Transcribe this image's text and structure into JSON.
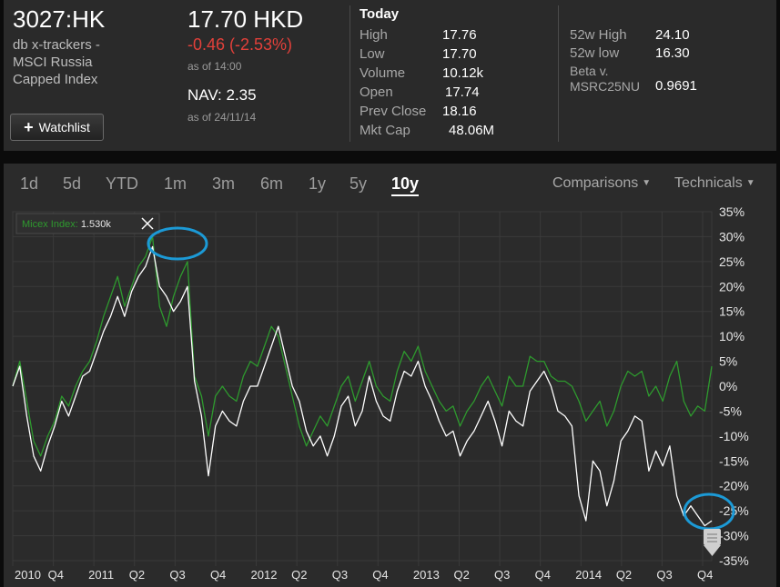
{
  "quote": {
    "ticker": "3027:HK",
    "name_lines": [
      "db x-trackers -",
      "MSCI Russia",
      "Capped Index"
    ],
    "watchlist_label": "Watchlist",
    "price": "17.70 HKD",
    "change": "-0.46 (-2.53%)",
    "price_asof": "as of 14:00",
    "nav": "NAV: 2.35",
    "nav_asof": "as of 24/11/14",
    "change_color": "#e2403a"
  },
  "today": {
    "title": "Today",
    "rows": [
      {
        "label": "High",
        "value": "17.76"
      },
      {
        "label": "Low",
        "value": "17.70"
      },
      {
        "label": "Volume",
        "value": "10.12k"
      },
      {
        "label": "Open",
        "value": "17.74"
      },
      {
        "label": "Prev Close",
        "value": "18.16"
      },
      {
        "label": "Mkt Cap",
        "value": "48.06M"
      }
    ]
  },
  "range52": {
    "high_label": "52w High",
    "high": "24.10",
    "low_label": "52w low",
    "low": "16.30",
    "beta_label_1": "Beta v.",
    "beta_label_2": "MSRC25NU",
    "beta": "0.9691"
  },
  "tabs": [
    "1d",
    "5d",
    "YTD",
    "1m",
    "3m",
    "6m",
    "1y",
    "5y",
    "10y"
  ],
  "active_tab": "10y",
  "dropdowns": {
    "comparisons": "Comparisons",
    "technicals": "Technicals"
  },
  "legend": {
    "label": "Micex Index:",
    "value": "1.530k"
  },
  "chart_data": {
    "type": "line",
    "x_tick_labels": [
      "2010",
      "Q4",
      "2011",
      "Q2",
      "Q3",
      "Q4",
      "2012",
      "Q2",
      "Q3",
      "Q4",
      "2013",
      "Q2",
      "Q3",
      "Q4",
      "2014",
      "Q2",
      "Q3",
      "Q4"
    ],
    "y_tick_labels": [
      "35%",
      "30%",
      "25%",
      "20%",
      "15%",
      "10%",
      "5%",
      "0%",
      "-5%",
      "-10%",
      "-15%",
      "-20%",
      "-25%",
      "-30%",
      "-35%"
    ],
    "ylim": [
      -35,
      35
    ],
    "ylabel": "",
    "series": [
      {
        "name": "",
        "color": "#ffffff",
        "x": [
          0,
          0.01,
          0.02,
          0.03,
          0.04,
          0.05,
          0.06,
          0.07,
          0.08,
          0.09,
          0.1,
          0.11,
          0.12,
          0.13,
          0.14,
          0.15,
          0.16,
          0.17,
          0.18,
          0.19,
          0.2,
          0.21,
          0.22,
          0.23,
          0.24,
          0.25,
          0.26,
          0.27,
          0.28,
          0.29,
          0.3,
          0.31,
          0.32,
          0.33,
          0.34,
          0.35,
          0.36,
          0.37,
          0.38,
          0.39,
          0.4,
          0.41,
          0.42,
          0.43,
          0.44,
          0.45,
          0.46,
          0.47,
          0.48,
          0.49,
          0.5,
          0.51,
          0.52,
          0.53,
          0.54,
          0.55,
          0.56,
          0.57,
          0.58,
          0.59,
          0.6,
          0.61,
          0.62,
          0.63,
          0.64,
          0.65,
          0.66,
          0.67,
          0.68,
          0.69,
          0.7,
          0.71,
          0.72,
          0.73,
          0.74,
          0.75,
          0.76,
          0.77,
          0.78,
          0.79,
          0.8,
          0.81,
          0.82,
          0.83,
          0.84,
          0.85,
          0.86,
          0.87,
          0.88,
          0.89,
          0.9,
          0.91,
          0.92,
          0.93,
          0.94,
          0.95,
          0.96,
          0.97,
          0.98,
          0.99,
          1.0
        ],
        "y": [
          0,
          4,
          -6,
          -14,
          -17,
          -12,
          -8,
          -3,
          -6,
          -2,
          2,
          3,
          7,
          11,
          14,
          18,
          14,
          19,
          22,
          24,
          28,
          20,
          18,
          15,
          17,
          20,
          1,
          -6,
          -18,
          -8,
          -5,
          -7,
          -8,
          -3,
          0,
          0,
          4,
          8,
          12,
          6,
          0,
          -3,
          -9,
          -12,
          -10,
          -14,
          -10,
          -4,
          -2,
          -8,
          -5,
          2,
          -3,
          -6,
          -7,
          -1,
          3,
          2,
          5,
          0,
          -3,
          -7,
          -10,
          -9,
          -14,
          -11,
          -9,
          -6,
          -3,
          -7,
          -12,
          -5,
          -7,
          -8,
          -1,
          1,
          3,
          0,
          -5,
          -6,
          -8,
          -22,
          -27,
          -15,
          -17,
          -24,
          -19,
          -11,
          -9,
          -6,
          -7,
          -17,
          -13,
          -16,
          -12,
          -22,
          -26,
          -24,
          -26,
          -28,
          -27
        ]
      },
      {
        "name": "Micex Index",
        "color": "#2e9a2e",
        "x": [
          0,
          0.01,
          0.02,
          0.03,
          0.04,
          0.05,
          0.06,
          0.07,
          0.08,
          0.09,
          0.1,
          0.11,
          0.12,
          0.13,
          0.14,
          0.15,
          0.16,
          0.17,
          0.18,
          0.19,
          0.2,
          0.21,
          0.22,
          0.23,
          0.24,
          0.25,
          0.26,
          0.27,
          0.28,
          0.29,
          0.3,
          0.31,
          0.32,
          0.33,
          0.34,
          0.35,
          0.36,
          0.37,
          0.38,
          0.39,
          0.4,
          0.41,
          0.42,
          0.43,
          0.44,
          0.45,
          0.46,
          0.47,
          0.48,
          0.49,
          0.5,
          0.51,
          0.52,
          0.53,
          0.54,
          0.55,
          0.56,
          0.57,
          0.58,
          0.59,
          0.6,
          0.61,
          0.62,
          0.63,
          0.64,
          0.65,
          0.66,
          0.67,
          0.68,
          0.69,
          0.7,
          0.71,
          0.72,
          0.73,
          0.74,
          0.75,
          0.76,
          0.77,
          0.78,
          0.79,
          0.8,
          0.81,
          0.82,
          0.83,
          0.84,
          0.85,
          0.86,
          0.87,
          0.88,
          0.89,
          0.9,
          0.91,
          0.92,
          0.93,
          0.94,
          0.95,
          0.96,
          0.97,
          0.98,
          0.99,
          1.0
        ],
        "y": [
          0,
          5,
          -3,
          -11,
          -14,
          -10,
          -7,
          -2,
          -4,
          0,
          3,
          5,
          9,
          14,
          18,
          22,
          16,
          20,
          24,
          26,
          30,
          16,
          12,
          18,
          22,
          25,
          2,
          -2,
          -10,
          -2,
          0,
          -2,
          -3,
          2,
          5,
          4,
          8,
          12,
          10,
          4,
          -2,
          -8,
          -12,
          -9,
          -6,
          -8,
          -4,
          0,
          2,
          -3,
          1,
          5,
          0,
          -2,
          -3,
          3,
          7,
          5,
          8,
          3,
          0,
          -3,
          -5,
          -4,
          -8,
          -5,
          -3,
          0,
          2,
          -1,
          -4,
          2,
          0,
          0,
          6,
          5,
          5,
          2,
          1,
          1,
          0,
          -3,
          -7,
          -5,
          -3,
          -8,
          -5,
          0,
          3,
          2,
          3,
          -2,
          0,
          -3,
          2,
          5,
          -3,
          -6,
          -4,
          -5,
          4
        ]
      }
    ],
    "legend": "top-left",
    "grid": true
  }
}
